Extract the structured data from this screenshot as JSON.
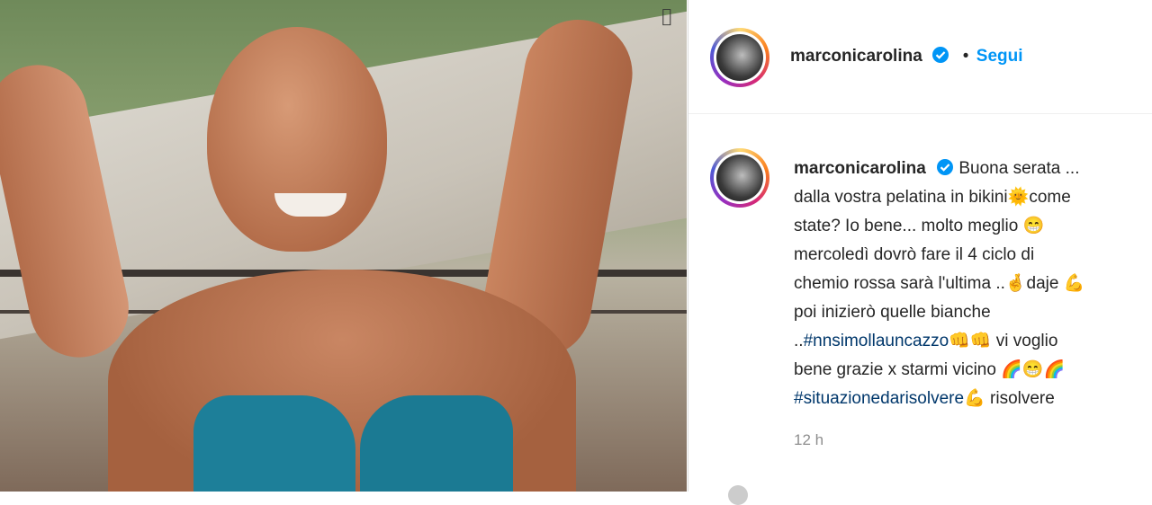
{
  "post": {
    "username": "marconicarolina",
    "separator": "•",
    "follow_label": "Segui",
    "caption_lines": [
      "Buona serata ...",
      "dalla vostra pelatina in bikini",
      "come",
      "state? Io bene... molto meglio",
      "mercoledì dovrò fare il 4 ciclo di",
      "chemio rossa sarà l'ultima ..",
      "daje",
      "poi inizierò quelle bianche",
      "..",
      "#nnsimollauncazzo",
      "vi voglio",
      "bene grazie x starmi vicino",
      "#situazionedarisolvere",
      "risolvere"
    ],
    "time_ago": "12 h"
  },
  "icons": {
    "sun": "🌞",
    "grin": "😁",
    "fingers": "🤞",
    "muscle": "💪",
    "fist": "👊",
    "rainbow": "🌈"
  },
  "colors": {
    "link_blue": "#0095f6",
    "hashtag": "#00376b",
    "text": "#262626",
    "muted": "#8e8e8e"
  }
}
